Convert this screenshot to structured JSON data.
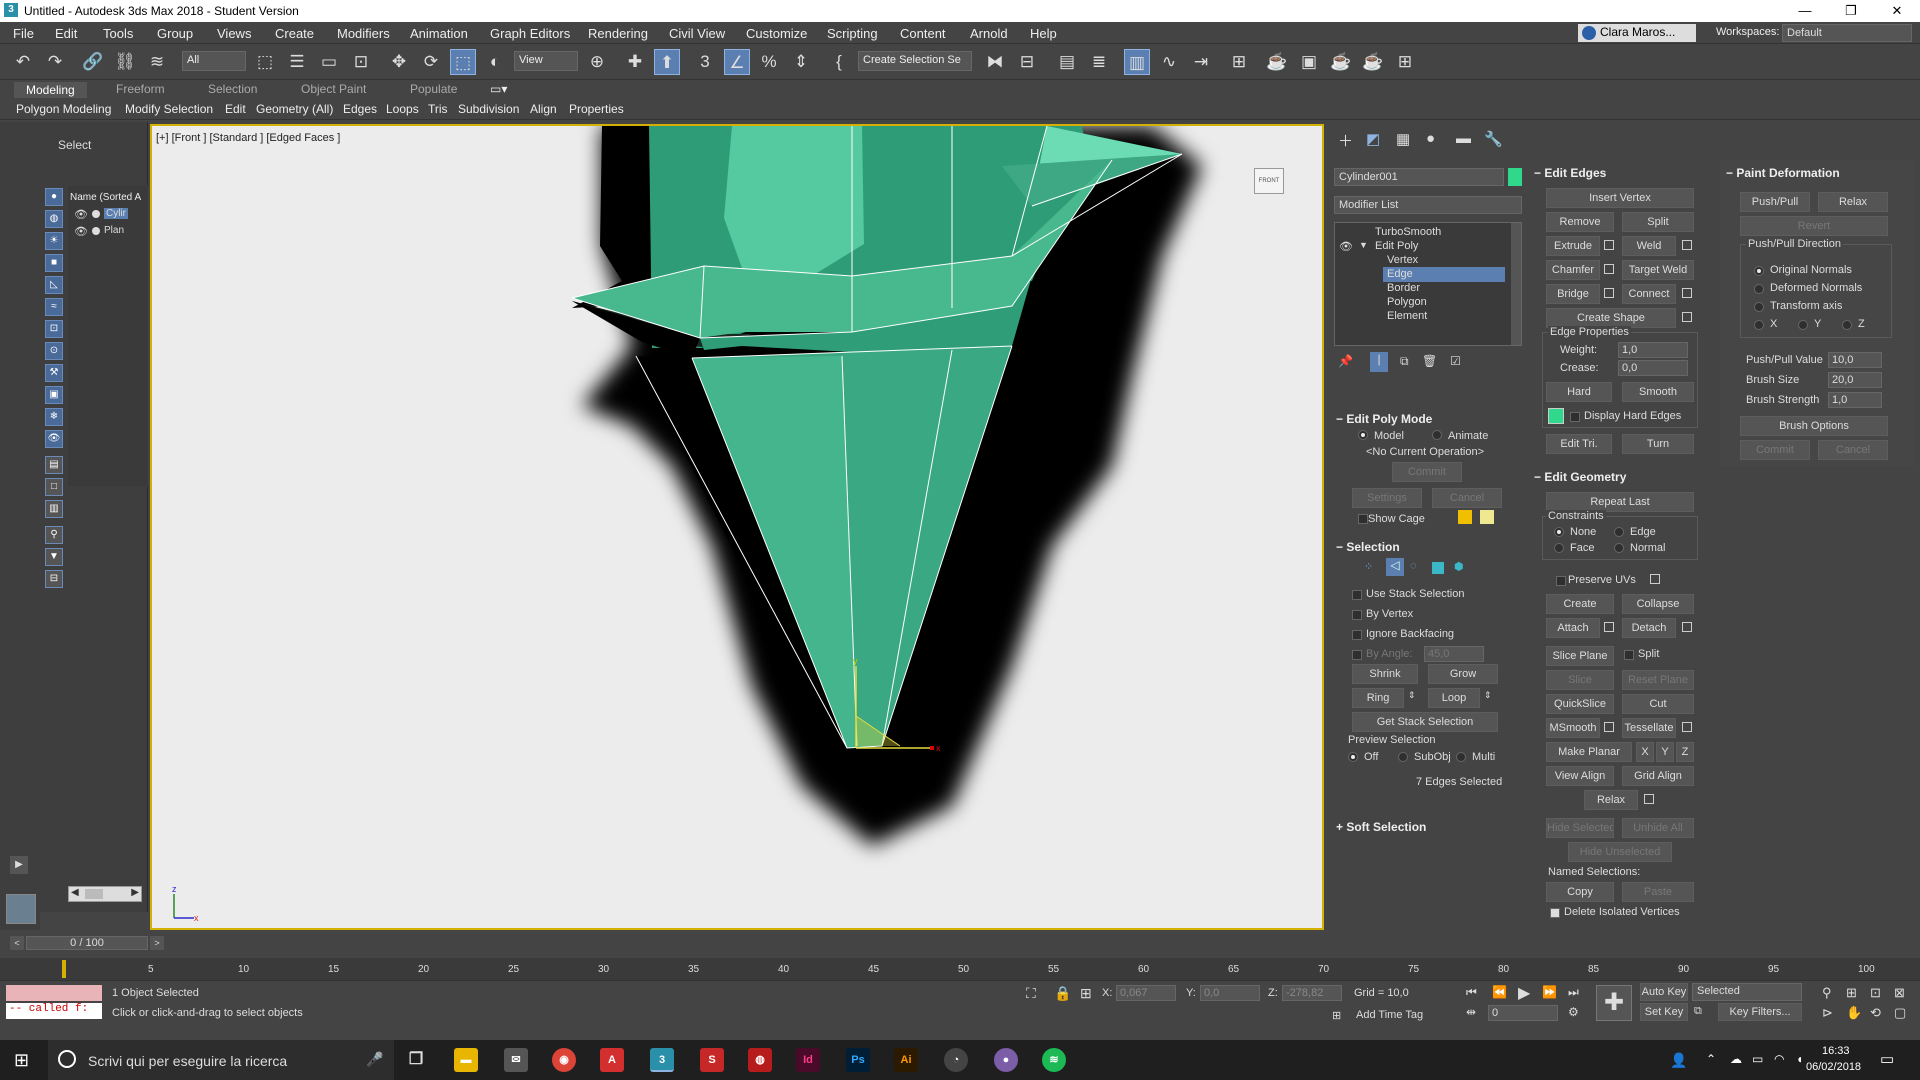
{
  "titlebar": {
    "title": "Untitled - Autodesk 3ds Max 2018 - Student Version",
    "app_icon": "3",
    "min": "—",
    "max": "❐",
    "close": "✕"
  },
  "menus": [
    "File",
    "Edit",
    "Tools",
    "Group",
    "Views",
    "Create",
    "Modifiers",
    "Animation",
    "Graph Editors",
    "Rendering",
    "Civil View",
    "Customize",
    "Scripting",
    "Content",
    "Arnold",
    "Help"
  ],
  "user": {
    "name": "Clara Maros...",
    "workspaces_label": "Workspaces:",
    "workspace": "Default"
  },
  "toolbar": {
    "filter": "All",
    "view": "View",
    "selection_set": "Create Selection Se"
  },
  "ribbon": {
    "tabs": [
      "Modeling",
      "Freeform",
      "Selection",
      "Object Paint",
      "Populate"
    ],
    "subtabs": [
      "Polygon Modeling",
      "Modify Selection",
      "Edit",
      "Geometry (All)",
      "Edges",
      "Loops",
      "Tris",
      "Subdivision",
      "Align",
      "Properties"
    ]
  },
  "explorer": {
    "select": "Select",
    "header": "Name (Sorted A",
    "items": [
      "Cylir",
      "Plan"
    ]
  },
  "viewport": {
    "label": "[+] [Front ] [Standard ] [Edged Faces ]",
    "viewcube": "FRONT"
  },
  "cmd": {
    "object_name": "Cylinder001",
    "object_color": "#2fd88a",
    "modifier_list": "Modifier List",
    "stack": [
      "TurboSmooth",
      "Edit Poly",
      "Vertex",
      "Edge",
      "Border",
      "Polygon",
      "Element"
    ],
    "edit_poly_mode": {
      "title": "Edit Poly Mode",
      "model": "Model",
      "animate": "Animate",
      "no_op": "<No Current Operation>",
      "commit": "Commit",
      "settings": "Settings",
      "cancel": "Cancel",
      "show_cage": "Show Cage"
    },
    "selection": {
      "title": "Selection",
      "use_stack": "Use Stack Selection",
      "by_vertex": "By Vertex",
      "ignore_backfacing": "Ignore Backfacing",
      "by_angle": "By Angle:",
      "angle": "45,0",
      "shrink": "Shrink",
      "grow": "Grow",
      "ring": "Ring",
      "loop": "Loop",
      "get_stack": "Get Stack Selection",
      "preview": "Preview Selection",
      "off": "Off",
      "subobj": "SubObj",
      "multi": "Multi",
      "status": "7 Edges Selected"
    },
    "soft_selection": "Soft Selection",
    "edit_edges": {
      "title": "Edit Edges",
      "insert_vertex": "Insert Vertex",
      "remove": "Remove",
      "split": "Split",
      "extrude": "Extrude",
      "weld": "Weld",
      "chamfer": "Chamfer",
      "target_weld": "Target Weld",
      "bridge": "Bridge",
      "connect": "Connect",
      "create_shape": "Create Shape",
      "edge_props": "Edge Properties",
      "weight_label": "Weight:",
      "weight": "1,0",
      "crease_label": "Crease:",
      "crease": "0,0",
      "hard": "Hard",
      "smooth": "Smooth",
      "display_hard": "Display Hard Edges",
      "edit_tri": "Edit Tri.",
      "turn": "Turn"
    },
    "edit_geometry": {
      "title": "Edit Geometry",
      "repeat_last": "Repeat Last",
      "constraints": "Constraints",
      "none": "None",
      "edge": "Edge",
      "face": "Face",
      "normal": "Normal",
      "preserve_uvs": "Preserve UVs",
      "create": "Create",
      "collapse": "Collapse",
      "attach": "Attach",
      "detach": "Detach",
      "slice_plane": "Slice Plane",
      "split": "Split",
      "slice": "Slice",
      "reset_plane": "Reset Plane",
      "quickslice": "QuickSlice",
      "cut": "Cut",
      "msmooth": "MSmooth",
      "tessellate": "Tessellate",
      "make_planar": "Make Planar",
      "x": "X",
      "y": "Y",
      "z": "Z",
      "view_align": "View Align",
      "grid_align": "Grid Align",
      "relax": "Relax",
      "hide_selected": "Hide Selected",
      "unhide_all": "Unhide All",
      "hide_unselected": "Hide Unselected",
      "named_sel": "Named Selections:",
      "copy": "Copy",
      "paste": "Paste",
      "delete_isolated": "Delete Isolated Vertices"
    },
    "paint_deformation": {
      "title": "Paint Deformation",
      "push_pull": "Push/Pull",
      "relax": "Relax",
      "revert": "Revert",
      "direction": "Push/Pull Direction",
      "original": "Original Normals",
      "deformed": "Deformed Normals",
      "transform_axis": "Transform axis",
      "x": "X",
      "y": "Y",
      "z": "Z",
      "value_label": "Push/Pull Value",
      "value": "10,0",
      "size_label": "Brush Size",
      "size": "20,0",
      "strength_label": "Brush Strength",
      "strength": "1,0",
      "options": "Brush Options",
      "commit": "Commit",
      "cancel": "Cancel"
    }
  },
  "timeline": {
    "frame": "0 / 100",
    "ticks": [
      "5",
      "10",
      "15",
      "20",
      "25",
      "30",
      "35",
      "40",
      "45",
      "50",
      "55",
      "60",
      "65",
      "70",
      "75",
      "80",
      "85",
      "90",
      "95",
      "100"
    ]
  },
  "status": {
    "objects": "1 Object Selected",
    "prompt": "Click or click-and-drag to select objects",
    "script": "-- called f:",
    "x_label": "X:",
    "x": "0,067",
    "y_label": "Y:",
    "y": "0,0",
    "z_label": "Z:",
    "z": "-278,82",
    "grid": "Grid = 10,0",
    "add_time_tag": "Add Time Tag",
    "auto_key": "Auto Key",
    "set_key": "Set Key",
    "selected": "Selected",
    "key_filters": "Key Filters...",
    "frame_field": "0"
  },
  "taskbar": {
    "search": "Scrivi qui per eseguire la ricerca",
    "time": "16:33",
    "date": "06/02/2018"
  }
}
